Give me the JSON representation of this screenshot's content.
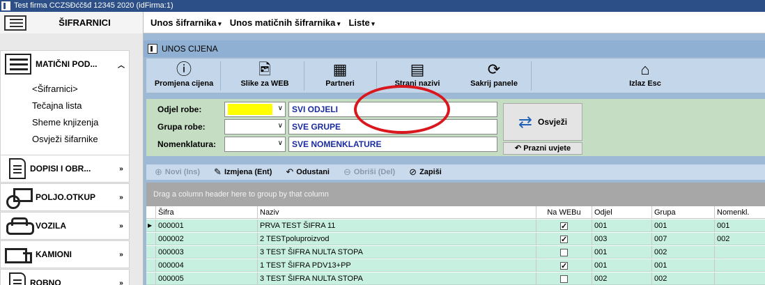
{
  "window": {
    "title": "Test firma CCZSĐćčšđ 12345  2020 (idFirma:1)"
  },
  "topmenu": {
    "sidebar_title": "ŠIFRARNICI",
    "items": [
      {
        "label": "Unos šifrarnika"
      },
      {
        "label": "Unos matičnih šifrarnika"
      },
      {
        "label": "Liste"
      }
    ]
  },
  "sidebar": {
    "groups": [
      {
        "label": "MATIČNI POD...",
        "chevron": "^",
        "icon": "list-icon"
      },
      {
        "label": "DOPISI I OBR...",
        "chevron": "»",
        "icon": "document-icon"
      },
      {
        "label": "POLJO.OTKUP",
        "chevron": "»",
        "icon": "tractor-icon"
      },
      {
        "label": "VOZILA",
        "chevron": "»",
        "icon": "car-icon"
      },
      {
        "label": "KAMIONI",
        "chevron": "»",
        "icon": "truck-icon"
      },
      {
        "label": "ROBNO",
        "chevron": "»",
        "icon": "boxes-icon"
      }
    ],
    "subitems": [
      "<Šifrarnici>",
      "Tečajna lista",
      "Sheme knjizenja",
      "Osvježi šifarnike"
    ]
  },
  "main": {
    "title": "UNOS CIJENA",
    "toolbar": [
      {
        "label": "Promjena cijena",
        "icon": "info-icon"
      },
      {
        "label": "Slike za WEB",
        "icon": "image-door-icon"
      },
      {
        "label": "Partneri",
        "icon": "partners-icon"
      },
      {
        "label": "Strani nazivi",
        "icon": "calculator-icon"
      },
      {
        "label": "Sakrij panele",
        "icon": "refresh-icon"
      },
      {
        "label": "Izlaz Esc",
        "icon": "home-icon"
      }
    ],
    "filters": [
      {
        "label": "Odjel robe:",
        "value": "SVI ODJELI"
      },
      {
        "label": "Grupa robe:",
        "value": "SVE GRUPE"
      },
      {
        "label": "Nomenklatura:",
        "value": "SVE NOMENKLATURE"
      }
    ],
    "refresh_label": "Osvježi",
    "clear_label": "Prazni uvjete",
    "actions": [
      {
        "label": "Novi (Ins)",
        "enabled": false
      },
      {
        "label": "Izmjena (Ent)",
        "enabled": true
      },
      {
        "label": "Odustani",
        "enabled": true
      },
      {
        "label": "Obriši (Del)",
        "enabled": false
      },
      {
        "label": "Zapiši",
        "enabled": true
      }
    ],
    "group_hint": "Drag a column header here to group by that column",
    "grid": {
      "columns": [
        "Šifra",
        "Naziv",
        "Na WEBu",
        "Odjel",
        "Grupa",
        "Nomenkl."
      ],
      "rows": [
        {
          "sifra": "000001",
          "naziv": "PRVA TEST ŠIFRA 11",
          "web": true,
          "odjel": "001",
          "grupa": "001",
          "nomenkl": "001",
          "current": true
        },
        {
          "sifra": "000002",
          "naziv": "2 TESTpoluproizvod",
          "web": true,
          "odjel": "003",
          "grupa": "007",
          "nomenkl": "002",
          "current": false
        },
        {
          "sifra": "000003",
          "naziv": "3 TEST ŠIFRA NULTA STOPA",
          "web": false,
          "odjel": "001",
          "grupa": "002",
          "nomenkl": "",
          "current": false
        },
        {
          "sifra": "000004",
          "naziv": "1 TEST ŠIFRA  PDV13+PP",
          "web": true,
          "odjel": "001",
          "grupa": "001",
          "nomenkl": "",
          "current": false
        },
        {
          "sifra": "000005",
          "naziv": "3 TEST ŠIFRA NULTA STOPA",
          "web": false,
          "odjel": "002",
          "grupa": "002",
          "nomenkl": "",
          "current": false
        }
      ]
    }
  },
  "colors": {
    "accent": "#2b4f86",
    "annotation": "#d9171e",
    "highlight": "#ffff00"
  }
}
